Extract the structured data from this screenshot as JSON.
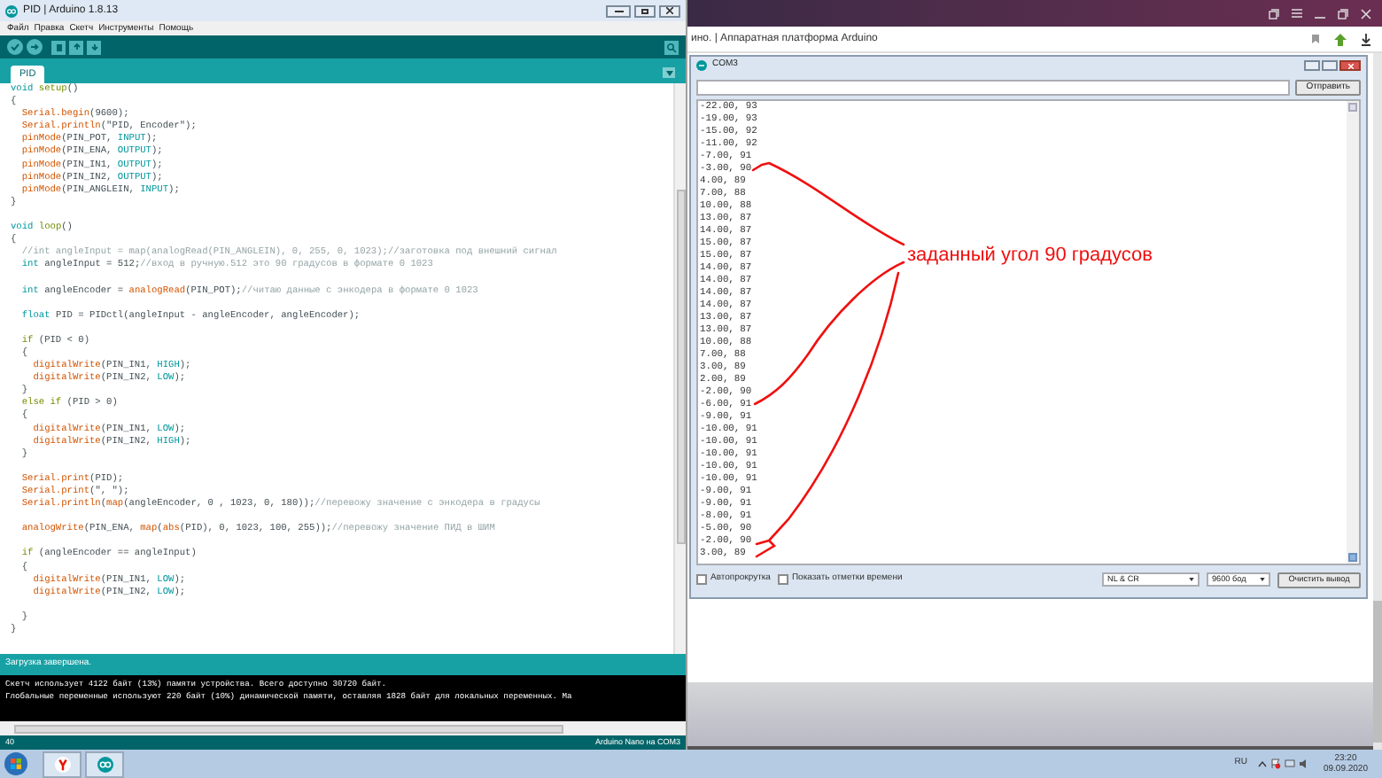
{
  "ide": {
    "title": "PID | Arduino 1.8.13",
    "menu": [
      "Файл",
      "Правка",
      "Скетч",
      "Инструменты",
      "Помощь"
    ],
    "tabs": [
      {
        "label": "PID",
        "selected": true
      }
    ],
    "code": [
      {
        "tokens": [
          {
            "text": "void ",
            "kind": "keyword"
          },
          {
            "text": "setup",
            "kind": "control"
          },
          {
            "text": "()",
            "kind": "plain"
          }
        ]
      },
      {
        "tokens": [
          {
            "text": "{",
            "kind": "plain"
          }
        ]
      },
      {
        "tokens": [
          {
            "text": "  Serial.begin",
            "kind": "function"
          },
          {
            "text": "(9600);",
            "kind": "plain"
          }
        ]
      },
      {
        "tokens": [
          {
            "text": "  Serial.println",
            "kind": "function"
          },
          {
            "text": "(\"PID, Encoder\");",
            "kind": "plain"
          }
        ]
      },
      {
        "tokens": [
          {
            "text": "  pinMode",
            "kind": "function"
          },
          {
            "text": "(PIN_POT, ",
            "kind": "plain"
          },
          {
            "text": "INPUT",
            "kind": "constant"
          },
          {
            "text": ");",
            "kind": "plain"
          }
        ]
      },
      {
        "tokens": [
          {
            "text": "  pinMode",
            "kind": "function"
          },
          {
            "text": "(PIN_ENA, ",
            "kind": "plain"
          },
          {
            "text": "OUTPUT",
            "kind": "constant"
          },
          {
            "text": ");",
            "kind": "plain"
          }
        ]
      },
      {
        "tokens": [
          {
            "text": "  pinMode",
            "kind": "function"
          },
          {
            "text": "(PIN_IN1, ",
            "kind": "plain"
          },
          {
            "text": "OUTPUT",
            "kind": "constant"
          },
          {
            "text": ");",
            "kind": "plain"
          }
        ]
      },
      {
        "tokens": [
          {
            "text": "  pinMode",
            "kind": "function"
          },
          {
            "text": "(PIN_IN2, ",
            "kind": "plain"
          },
          {
            "text": "OUTPUT",
            "kind": "constant"
          },
          {
            "text": ");",
            "kind": "plain"
          }
        ]
      },
      {
        "tokens": [
          {
            "text": "  pinMode",
            "kind": "function"
          },
          {
            "text": "(PIN_ANGLEIN, ",
            "kind": "plain"
          },
          {
            "text": "INPUT",
            "kind": "constant"
          },
          {
            "text": ");",
            "kind": "plain"
          }
        ]
      },
      {
        "tokens": [
          {
            "text": "}",
            "kind": "plain"
          }
        ]
      },
      {
        "blank_before": true,
        "tokens": [
          {
            "text": "void ",
            "kind": "keyword"
          },
          {
            "text": "loop",
            "kind": "control"
          },
          {
            "text": "()",
            "kind": "plain"
          }
        ]
      },
      {
        "tokens": [
          {
            "text": "{",
            "kind": "plain"
          }
        ]
      },
      {
        "tokens": [
          {
            "text": "  //int angleInput = map(analogRead(PIN_ANGLEIN), 0, 255, 0, 1023);//заготовка под внешний сигнал",
            "kind": "comment"
          }
        ]
      },
      {
        "tokens": [
          {
            "text": "  int",
            "kind": "keyword"
          },
          {
            "text": " angleInput = 512;",
            "kind": "plain"
          },
          {
            "text": "//вход в ручную.512 это 90 градусов в формате 0 1023",
            "kind": "comment"
          }
        ]
      },
      {
        "blank_before": true,
        "tokens": [
          {
            "text": "  int",
            "kind": "keyword"
          },
          {
            "text": " angleEncoder = ",
            "kind": "plain"
          },
          {
            "text": "analogRead",
            "kind": "function"
          },
          {
            "text": "(PIN_POT);",
            "kind": "plain"
          },
          {
            "text": "//читаю данные с энкодера в формате 0 1023",
            "kind": "comment"
          }
        ]
      },
      {
        "blank_before": true,
        "tokens": [
          {
            "text": "  float",
            "kind": "keyword"
          },
          {
            "text": " PID = PIDctl(angleInput - angleEncoder, angleEncoder);",
            "kind": "plain"
          }
        ]
      },
      {
        "blank_before": true,
        "tokens": [
          {
            "text": "  if",
            "kind": "control"
          },
          {
            "text": " (PID < 0)",
            "kind": "plain"
          }
        ]
      },
      {
        "tokens": [
          {
            "text": "  {",
            "kind": "plain"
          }
        ]
      },
      {
        "tokens": [
          {
            "text": "    digitalWrite",
            "kind": "function"
          },
          {
            "text": "(PIN_IN1, ",
            "kind": "plain"
          },
          {
            "text": "HIGH",
            "kind": "constant"
          },
          {
            "text": ");",
            "kind": "plain"
          }
        ]
      },
      {
        "tokens": [
          {
            "text": "    digitalWrite",
            "kind": "function"
          },
          {
            "text": "(PIN_IN2, ",
            "kind": "plain"
          },
          {
            "text": "LOW",
            "kind": "constant"
          },
          {
            "text": ");",
            "kind": "plain"
          }
        ]
      },
      {
        "tokens": [
          {
            "text": "  }",
            "kind": "plain"
          }
        ]
      },
      {
        "tokens": [
          {
            "text": "  else if",
            "kind": "control"
          },
          {
            "text": " (PID > 0)",
            "kind": "plain"
          }
        ]
      },
      {
        "tokens": [
          {
            "text": "  {",
            "kind": "plain"
          }
        ]
      },
      {
        "tokens": [
          {
            "text": "    digitalWrite",
            "kind": "function"
          },
          {
            "text": "(PIN_IN1, ",
            "kind": "plain"
          },
          {
            "text": "LOW",
            "kind": "constant"
          },
          {
            "text": ");",
            "kind": "plain"
          }
        ]
      },
      {
        "tokens": [
          {
            "text": "    digitalWrite",
            "kind": "function"
          },
          {
            "text": "(PIN_IN2, ",
            "kind": "plain"
          },
          {
            "text": "HIGH",
            "kind": "constant"
          },
          {
            "text": ");",
            "kind": "plain"
          }
        ]
      },
      {
        "tokens": [
          {
            "text": "  }",
            "kind": "plain"
          }
        ]
      },
      {
        "blank_before": true,
        "tokens": [
          {
            "text": "  Serial.print",
            "kind": "function"
          },
          {
            "text": "(PID);",
            "kind": "plain"
          }
        ]
      },
      {
        "tokens": [
          {
            "text": "  Serial.print",
            "kind": "function"
          },
          {
            "text": "(\", \");",
            "kind": "plain"
          }
        ]
      },
      {
        "tokens": [
          {
            "text": "  Serial.println",
            "kind": "function"
          },
          {
            "text": "(",
            "kind": "plain"
          },
          {
            "text": "map",
            "kind": "function"
          },
          {
            "text": "(angleEncoder, 0 , 1023, 0, 180));",
            "kind": "plain"
          },
          {
            "text": "//перевожу значение с энкодера в градусы",
            "kind": "comment"
          }
        ]
      },
      {
        "blank_before": true,
        "tokens": [
          {
            "text": "  analogWrite",
            "kind": "function"
          },
          {
            "text": "(PIN_ENA, ",
            "kind": "plain"
          },
          {
            "text": "map",
            "kind": "function"
          },
          {
            "text": "(",
            "kind": "plain"
          },
          {
            "text": "abs",
            "kind": "function"
          },
          {
            "text": "(PID), 0, 1023, 100, 255));",
            "kind": "plain"
          },
          {
            "text": "//перевожу значение ПИД в ШИМ",
            "kind": "comment"
          }
        ]
      },
      {
        "blank_before": true,
        "tokens": [
          {
            "text": "  if",
            "kind": "control"
          },
          {
            "text": " (angleEncoder == angleInput)",
            "kind": "plain"
          }
        ]
      },
      {
        "tokens": [
          {
            "text": "  {",
            "kind": "plain"
          }
        ]
      },
      {
        "tokens": [
          {
            "text": "    digitalWrite",
            "kind": "function"
          },
          {
            "text": "(PIN_IN1, ",
            "kind": "plain"
          },
          {
            "text": "LOW",
            "kind": "constant"
          },
          {
            "text": ");",
            "kind": "plain"
          }
        ]
      },
      {
        "tokens": [
          {
            "text": "    digitalWrite",
            "kind": "function"
          },
          {
            "text": "(PIN_IN2, ",
            "kind": "plain"
          },
          {
            "text": "LOW",
            "kind": "constant"
          },
          {
            "text": ");",
            "kind": "plain"
          }
        ]
      },
      {
        "blank_before": true,
        "tokens": [
          {
            "text": "  }",
            "kind": "plain"
          }
        ]
      },
      {
        "tokens": [
          {
            "text": "}",
            "kind": "plain"
          }
        ]
      }
    ],
    "status": "Загрузка завершена.",
    "console": [
      "Скетч использует 4122 байт (13%) памяти устройства. Всего доступно 30720 байт.",
      "Глобальные переменные используют 220 байт (10%) динамической памяти, оставляя 1828 байт для локальных переменных. Ма"
    ],
    "line_number": "40",
    "board": "Arduino Nano на COM3"
  },
  "browser": {
    "page_title": "ино. | Аппаратная платформа Arduino"
  },
  "serial_monitor": {
    "title": "COM3",
    "send_button": "Отправить",
    "lines": [
      "-22.00, 93",
      "-19.00, 93",
      "-15.00, 92",
      "-11.00, 92",
      "-7.00, 91",
      "-3.00, 90",
      "4.00, 89",
      "7.00, 88",
      "10.00, 88",
      "13.00, 87",
      "14.00, 87",
      "15.00, 87",
      "15.00, 87",
      "14.00, 87",
      "14.00, 87",
      "14.00, 87",
      "14.00, 87",
      "13.00, 87",
      "13.00, 87",
      "10.00, 88",
      "7.00, 88",
      "3.00, 89",
      "2.00, 89",
      "-2.00, 90",
      "-6.00, 91",
      "-9.00, 91",
      "-10.00, 91",
      "-10.00, 91",
      "-10.00, 91",
      "-10.00, 91",
      "-10.00, 91",
      "-9.00, 91",
      "-9.00, 91",
      "-8.00, 91",
      "-5.00, 90",
      "-2.00, 90",
      "3.00, 89"
    ],
    "autoscroll": {
      "label": "Автопрокрутка",
      "checked": false
    },
    "timestamps": {
      "label": "Показать отметки времени",
      "checked": false
    },
    "line_ending": "NL & CR",
    "baud": "9600 бод",
    "clear_button": "Очистить вывод"
  },
  "annotation": "заданный угол 90 градусов",
  "taskbar": {
    "language": "RU",
    "time": "23:20",
    "date": "09.09.2020"
  }
}
